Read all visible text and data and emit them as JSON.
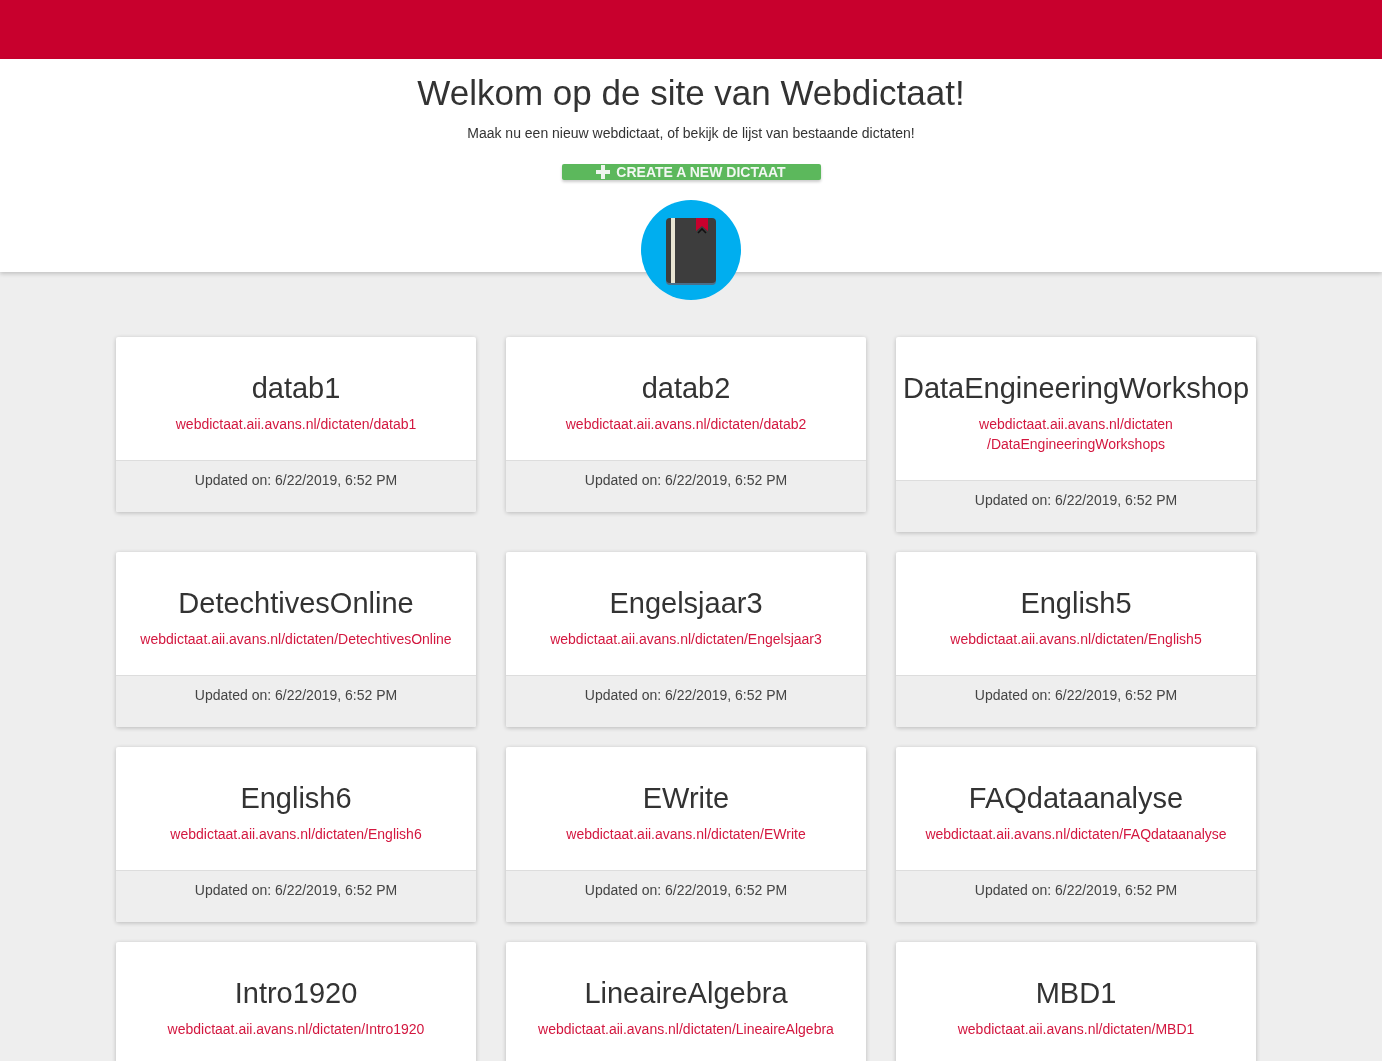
{
  "header": {
    "title": "Welkom op de site van Webdictaat!",
    "subtitle": "Maak nu een nieuw webdictaat, of bekijk de lijst van bestaande dictaten!",
    "create_button": {
      "label": "CREATE A NEW DICTAAT"
    }
  },
  "dictaten": [
    {
      "name": "datab1",
      "url": "webdictaat.aii.avans.nl/dictaten/datab1",
      "updated": "Updated on: 6/22/2019, 6:52 PM"
    },
    {
      "name": "datab2",
      "url": "webdictaat.aii.avans.nl/dictaten/datab2",
      "updated": "Updated on: 6/22/2019, 6:52 PM"
    },
    {
      "name": "DataEngineeringWorkshop",
      "url": "webdictaat.aii.avans.nl/dictaten/DataEngineeringWorkshops",
      "updated": "Updated on: 6/22/2019, 6:52 PM"
    },
    {
      "name": "DetechtivesOnline",
      "url": "webdictaat.aii.avans.nl/dictaten/DetechtivesOnline",
      "updated": "Updated on: 6/22/2019, 6:52 PM"
    },
    {
      "name": "Engelsjaar3",
      "url": "webdictaat.aii.avans.nl/dictaten/Engelsjaar3",
      "updated": "Updated on: 6/22/2019, 6:52 PM"
    },
    {
      "name": "English5",
      "url": "webdictaat.aii.avans.nl/dictaten/English5",
      "updated": "Updated on: 6/22/2019, 6:52 PM"
    },
    {
      "name": "English6",
      "url": "webdictaat.aii.avans.nl/dictaten/English6",
      "updated": "Updated on: 6/22/2019, 6:52 PM"
    },
    {
      "name": "EWrite",
      "url": "webdictaat.aii.avans.nl/dictaten/EWrite",
      "updated": "Updated on: 6/22/2019, 6:52 PM"
    },
    {
      "name": "FAQdataanalyse",
      "url": "webdictaat.aii.avans.nl/dictaten/FAQdataanalyse",
      "updated": "Updated on: 6/22/2019, 6:52 PM"
    },
    {
      "name": "Intro1920",
      "url": "webdictaat.aii.avans.nl/dictaten/Intro1920"
    },
    {
      "name": "LineaireAlgebra",
      "url": "webdictaat.aii.avans.nl/dictaten/LineaireAlgebra"
    },
    {
      "name": "MBD1",
      "url": "webdictaat.aii.avans.nl/dictaten/MBD1"
    }
  ]
}
